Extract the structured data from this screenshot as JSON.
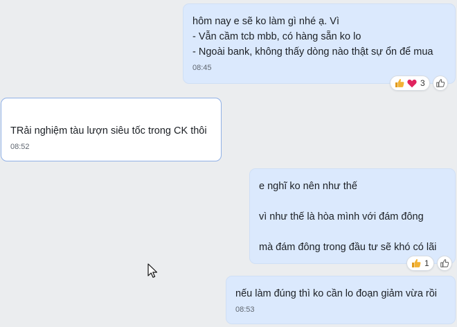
{
  "colors": {
    "background": "#ebedef",
    "outgoing_bubble": "#dbe9fd",
    "incoming_bubble": "#ffffff",
    "incoming_border": "#8fb0e6",
    "heart": "#e0245e",
    "thumb": "#f2b233"
  },
  "messages": [
    {
      "direction": "outgoing",
      "lines": [
        "hôm nay e sẽ ko làm gì nhé ạ. Vì",
        "- Vẫn cầm tcb mbb, có hàng sẵn ko lo",
        "- Ngoài bank, không thấy dòng nào thật sự ổn để mua"
      ],
      "time": "08:45",
      "reactions": {
        "icons": [
          "thumbs-up-icon",
          "heart-icon"
        ],
        "count": "3"
      }
    },
    {
      "direction": "incoming",
      "lines": [
        "TRải nghiệm tàu lượn siêu tốc trong CK thôi"
      ],
      "time": "08:52"
    },
    {
      "direction": "outgoing",
      "lines": [
        "e nghĩ ko nên như thế",
        "",
        "vì như thế là hòa mình với đám đông",
        "",
        "mà đám đông trong đầu tư sẽ khó có lãi"
      ],
      "reactions": {
        "icons": [
          "thumbs-up-icon"
        ],
        "count": "1"
      }
    },
    {
      "direction": "outgoing",
      "lines": [
        "nếu làm đúng thì ko cần lo đoạn giảm vừa rồi"
      ],
      "time": "08:53"
    }
  ]
}
